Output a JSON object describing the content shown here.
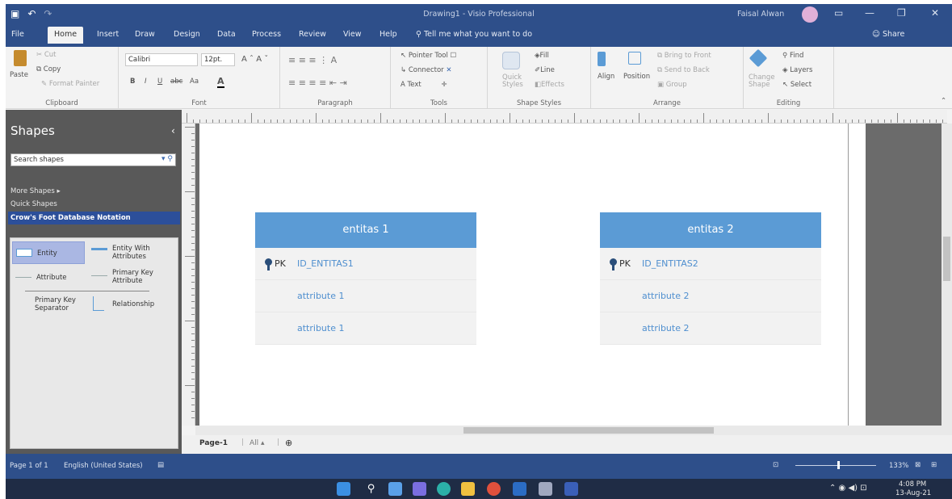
{
  "window": {
    "title": "Drawing1 - Visio Professional",
    "user": "Faisal Alwan"
  },
  "tabs": [
    "File",
    "Home",
    "Insert",
    "Draw",
    "Design",
    "Data",
    "Process",
    "Review",
    "View",
    "Help"
  ],
  "tell_me": "Tell me what you want to do",
  "share": "Share",
  "ribbon": {
    "clipboard": {
      "paste": "Paste",
      "cut": "Cut",
      "copy": "Copy",
      "format_painter": "Format Painter",
      "label": "Clipboard"
    },
    "font": {
      "family": "Calibri",
      "size": "12pt.",
      "label": "Font",
      "b": "B",
      "i": "I",
      "u": "U",
      "abc": "abc",
      "aa": "Aa"
    },
    "paragraph": {
      "label": "Paragraph"
    },
    "tools": {
      "pointer": "Pointer Tool",
      "connector": "Connector",
      "text": "Text",
      "label": "Tools",
      "a": "A"
    },
    "shape_styles": {
      "quick_styles": "Quick Styles",
      "fill": "Fill",
      "line": "Line",
      "effects": "Effects",
      "label": "Shape Styles"
    },
    "arrange": {
      "align": "Align",
      "position": "Position",
      "bring_front": "Bring to Front",
      "send_back": "Send to Back",
      "group": "Group",
      "label": "Arrange"
    },
    "editing": {
      "change_shape": "Change Shape",
      "find": "Find",
      "layers": "Layers",
      "select": "Select",
      "label": "Editing"
    }
  },
  "shapes_pane": {
    "title": "Shapes",
    "search": "Search shapes",
    "more_shapes": "More Shapes",
    "quick_shapes": "Quick Shapes",
    "stencil": "Crow's Foot Database Notation",
    "items": {
      "entity": "Entity",
      "entity_attrs_1": "Entity With",
      "entity_attrs_2": "Attributes",
      "attribute": "Attribute",
      "pk_attr_1": "Primary Key",
      "pk_attr_2": "Attribute",
      "pk_sep_1": "Primary Key",
      "pk_sep_2": "Separator",
      "relationship": "Relationship"
    }
  },
  "canvas": {
    "entities": [
      {
        "name": "entitas 1",
        "pk_label": "PK",
        "pk": "ID_ENTITAS1",
        "attrs": [
          "attribute 1",
          "attribute 1"
        ]
      },
      {
        "name": "entitas 2",
        "pk_label": "PK",
        "pk": "ID_ENTITAS2",
        "attrs": [
          "attribute 2",
          "attribute 2"
        ]
      }
    ]
  },
  "page_tabs": {
    "page": "Page-1",
    "all": "All",
    "add": "⊕"
  },
  "status": {
    "page": "Page 1 of 1",
    "lang": "English (United States)",
    "zoom": "133%"
  },
  "clock": {
    "time": "4:08 PM",
    "date": "13-Aug-21"
  }
}
